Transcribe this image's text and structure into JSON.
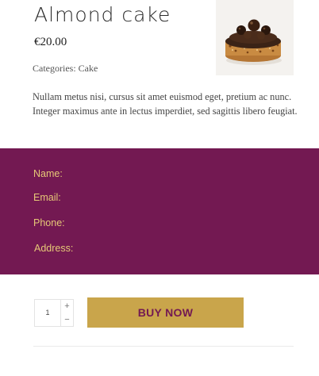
{
  "product": {
    "title": "Almond cake",
    "price": "€20.00",
    "categories": "Categories: Cake",
    "description": "Nullam metus nisi, cursus sit amet euismod eget, pretium ac nunc. Integer maximus ante in lectus imperdiet, sed sagittis libero feugiat."
  },
  "form": {
    "name_label": "Name:",
    "email_label": "Email:",
    "phone_label": "Phone:",
    "address_label": "Address:"
  },
  "purchase": {
    "quantity": "1",
    "increment": "+",
    "decrement": "−",
    "buy_label": "BUY NOW"
  },
  "colors": {
    "form_background": "#731952",
    "form_label": "#e6c877",
    "button_background": "#c9a54b",
    "button_text": "#731952"
  }
}
